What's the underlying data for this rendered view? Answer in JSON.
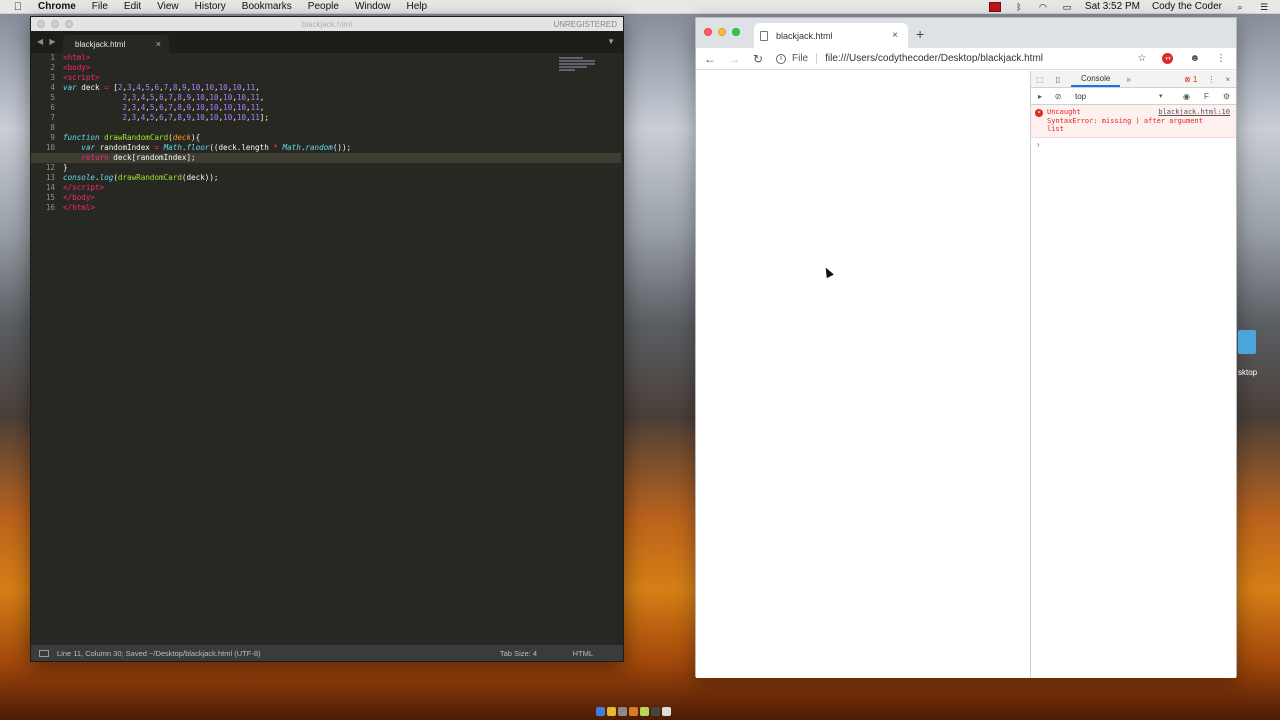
{
  "menubar": {
    "app_name": "Chrome",
    "items": [
      "File",
      "Edit",
      "View",
      "History",
      "Bookmarks",
      "People",
      "Window",
      "Help"
    ],
    "clock": "Sat 3:52 PM",
    "user": "Cody the Coder"
  },
  "sublime": {
    "title": "blackjack.html",
    "unregistered": "UNREGISTERED",
    "tab_label": "blackjack.html",
    "status": {
      "position": "Line 11, Column 30; Saved ~/Desktop/blackjack.html (UTF-8)",
      "tab_size": "Tab Size: 4",
      "syntax": "HTML"
    },
    "line_numbers": [
      "1",
      "2",
      "3",
      "4",
      "5",
      "6",
      "7",
      "8",
      "9",
      "10",
      "11",
      "12",
      "13",
      "14",
      "15",
      "16"
    ],
    "active_line": 11
  },
  "chrome": {
    "tab_title": "blackjack.html",
    "scheme_label": "File",
    "url": "file:///Users/codythecoder/Desktop/blackjack.html",
    "devtools": {
      "active_tab": "Console",
      "error_count": "1",
      "context": "top",
      "error_line1": "Uncaught",
      "error_line2": "SyntaxError: missing ) after argument",
      "error_line3": "list",
      "error_source": "blackjack.html:10",
      "prompt": "›"
    }
  },
  "desktop": {
    "folder_label": "sktop"
  },
  "colors": {
    "sublime_bg": "#272822",
    "monokai_pink": "#f92672",
    "monokai_purple": "#ae81ff",
    "monokai_green": "#a6e22e",
    "monokai_blue": "#66d9ef",
    "error_red": "#e0271c"
  }
}
